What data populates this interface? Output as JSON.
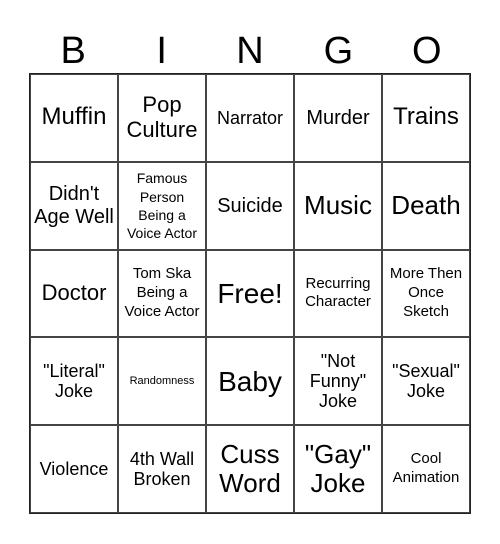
{
  "header": {
    "letters": [
      "B",
      "I",
      "N",
      "G",
      "O"
    ]
  },
  "cells": [
    "Muffin",
    "Pop Culture",
    "Narrator",
    "Murder",
    "Trains",
    "Didn't Age Well",
    "Famous Person Being a Voice Actor",
    "Suicide",
    "Music",
    "Death",
    "Doctor",
    "Tom Ska Being a Voice Actor",
    "Free!",
    "Recurring Character",
    "More Then Once Sketch",
    "\"Literal\" Joke",
    "Randomness",
    "Baby",
    "\"Not Funny\" Joke",
    "\"Sexual\" Joke",
    "Violence",
    "4th Wall Broken",
    "Cuss Word",
    "\"Gay\" Joke",
    "Cool Animation"
  ]
}
